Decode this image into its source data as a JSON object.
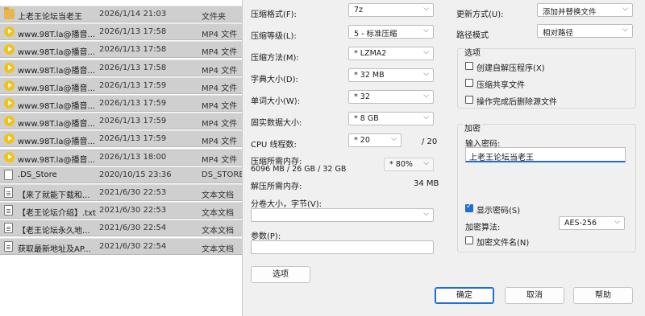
{
  "explorer": {
    "files": [
      {
        "icon": "folder-icon",
        "name": "上老王论坛当老王",
        "date": "2026/1/14 21:03",
        "type": "文件夹"
      },
      {
        "icon": "mp4-file-icon",
        "name": "www.98T.la@播音...",
        "date": "2026/1/13 17:58",
        "type": "MP4 文件"
      },
      {
        "icon": "mp4-file-icon",
        "name": "www.98T.la@播音...",
        "date": "2026/1/13 17:58",
        "type": "MP4 文件"
      },
      {
        "icon": "mp4-file-icon",
        "name": "www.98T.la@播音...",
        "date": "2026/1/13 17:58",
        "type": "MP4 文件"
      },
      {
        "icon": "mp4-file-icon",
        "name": "www.98T.la@播音...",
        "date": "2026/1/13 17:59",
        "type": "MP4 文件"
      },
      {
        "icon": "mp4-file-icon",
        "name": "www.98T.la@播音...",
        "date": "2026/1/13 17:59",
        "type": "MP4 文件"
      },
      {
        "icon": "mp4-file-icon",
        "name": "www.98T.la@播音...",
        "date": "2026/1/13 17:59",
        "type": "MP4 文件"
      },
      {
        "icon": "mp4-file-icon",
        "name": "www.98T.la@播音...",
        "date": "2026/1/13 17:59",
        "type": "MP4 文件"
      },
      {
        "icon": "mp4-file-icon",
        "name": "www.98T.la@播音...",
        "date": "2026/1/13 18:00",
        "type": "MP4 文件"
      },
      {
        "icon": "blank-file-icon",
        "name": ".DS_Store",
        "date": "2020/10/15 23:36",
        "type": "DS_STORE"
      },
      {
        "icon": "text-file-icon",
        "name": "【来了就能下载和...",
        "date": "2021/6/30 22:53",
        "type": "文本文档"
      },
      {
        "icon": "text-file-icon",
        "name": "【老王论坛介绍】.txt",
        "date": "2021/6/30 22:53",
        "type": "文本文档"
      },
      {
        "icon": "text-file-icon",
        "name": "【老王论坛永久地...",
        "date": "2021/6/30 22:54",
        "type": "文本文档"
      },
      {
        "icon": "text-file-icon",
        "name": "获取最新地址及AP...",
        "date": "2021/6/30 22:54",
        "type": "文本文档"
      }
    ]
  },
  "dialog": {
    "format": {
      "label": "压缩格式(F):",
      "value": "7z"
    },
    "level": {
      "label": "压缩等级(L):",
      "value": "5 - 标准压缩"
    },
    "method": {
      "label": "压缩方法(M):",
      "value": "* LZMA2"
    },
    "dict": {
      "label": "字典大小(D):",
      "value": "* 32 MB"
    },
    "word": {
      "label": "单词大小(W):",
      "value": "* 32"
    },
    "solid": {
      "label": "固实数据大小:",
      "value": "* 8 GB"
    },
    "cpu": {
      "label": "CPU 线程数:",
      "value": "* 20",
      "total": "/ 20"
    },
    "mem_compress": {
      "label": "压缩所需内存:",
      "detail": "6096 MB / 26 GB / 32 GB",
      "value": "* 80%"
    },
    "mem_decompress": {
      "label": "解压所需内存:",
      "value": "34 MB"
    },
    "split": {
      "label": "分卷大小，字节(V):",
      "value": ""
    },
    "params": {
      "label": "参数(P):",
      "value": ""
    },
    "options_button": "选项",
    "update": {
      "label": "更新方式(U):",
      "value": "添加并替换文件"
    },
    "path": {
      "label": "路径模式",
      "value": "相对路径"
    },
    "options_group": {
      "title": "选项",
      "items": [
        {
          "label": "创建自解压程序(X)",
          "checked": false
        },
        {
          "label": "压缩共享文件",
          "checked": false
        },
        {
          "label": "操作完成后删除源文件",
          "checked": false
        }
      ]
    },
    "encryption": {
      "title": "加密",
      "password_label": "输入密码:",
      "password": "上老王论坛当老王",
      "show_password": {
        "label": "显示密码(S)",
        "checked": true
      },
      "method_label": "加密算法:",
      "method_value": "AES-256",
      "encrypt_names": {
        "label": "加密文件名(N)",
        "checked": false
      }
    },
    "buttons": {
      "ok": "确定",
      "cancel": "取消",
      "help": "帮助"
    }
  }
}
